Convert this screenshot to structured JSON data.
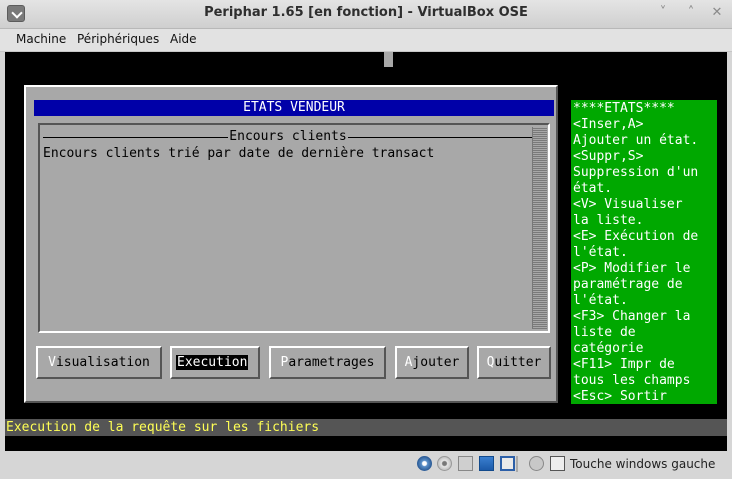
{
  "window": {
    "title": "Periphar 1.65 [en fonction] - VirtualBox OSE"
  },
  "menubar": {
    "machine": "Machine",
    "peripheriques": "Périphériques",
    "aide": "Aide"
  },
  "dialog": {
    "title": "ETATS VENDEUR",
    "list_header": "Encours clients",
    "list_rows": [
      "Encours clients trié par date de dernière transact"
    ],
    "buttons": [
      {
        "hotkey": "V",
        "rest": "isualisation"
      },
      {
        "hotkey": "E",
        "rest": "xecution",
        "selected": true
      },
      {
        "hotkey": "P",
        "rest": "arametrages"
      },
      {
        "hotkey": "A",
        "rest": "jouter"
      },
      {
        "hotkey": "Q",
        "rest": "uitter"
      }
    ]
  },
  "help_panel": {
    "lines": [
      "****ETATS****",
      "<Inser,A>",
      "Ajouter un état.",
      "<Suppr,S>",
      "Suppression d'un",
      "état.",
      "<V> Visualiser",
      "la liste.",
      "<E> Exécution de",
      "l'état.",
      "<P> Modifier le",
      "paramétrage de",
      "l'état.",
      "<F3> Changer la",
      "liste de",
      "catégorie",
      "<F11> Impr de",
      "tous les champs",
      "<Esc> Sortir"
    ]
  },
  "statusline": {
    "text": "Execution de la requête sur les fichiers"
  },
  "hostbar": {
    "keyboard_label": "Touche windows gauche",
    "icons": [
      "hard-disk-icon",
      "optical-drive-icon",
      "floppy-icon",
      "network-icon",
      "usb-icon",
      "shared-folders-icon",
      "mouse-integration-icon",
      "host-key-icon"
    ]
  },
  "colors": {
    "dialog_bg": "#a8a8a8",
    "title_bar": "#0000a8",
    "help_bg": "#00a800",
    "status_text": "#ffff55"
  }
}
